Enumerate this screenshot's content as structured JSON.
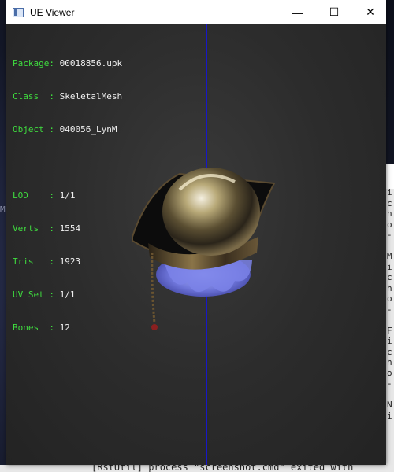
{
  "desktop": {
    "left_glyph": "M",
    "console_lines": [
      "i",
      "c",
      "h",
      "o",
      "-",
      "",
      "M",
      "i",
      "c",
      "h",
      "o",
      "-",
      "",
      "F",
      "i",
      "c",
      "h",
      "o",
      "-",
      "",
      "N",
      "i"
    ],
    "bottom_text": "[RstUtil] process \"screenshot.cmd\" exited with"
  },
  "window": {
    "title": "UE Viewer",
    "minimize_glyph": "—",
    "maximize_glyph": "☐",
    "close_glyph": "✕"
  },
  "info": {
    "package_key": "Package: ",
    "package_val": "00018856.upk",
    "class_key": "Class  : ",
    "class_val": "SkeletalMesh",
    "object_key": "Object : ",
    "object_val": "040056_LynM",
    "lod_key": "LOD    : ",
    "lod_val": "1/1",
    "verts_key": "Verts  : ",
    "verts_val": "1554",
    "tris_key": "Tris   : ",
    "tris_val": "1923",
    "uvset_key": "UV Set : ",
    "uvset_val": "1/1",
    "bones_key": "Bones  : ",
    "bones_val": "12"
  },
  "colors": {
    "label_green": "#3fdc3f",
    "axis_blue": "#1717c8",
    "viewport_bg": "#2c2c2c"
  }
}
